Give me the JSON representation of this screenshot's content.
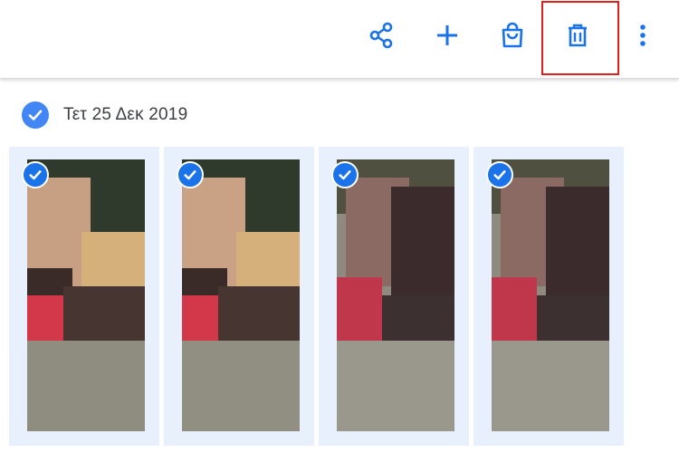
{
  "toolbar": {
    "share_icon": "share-icon",
    "add_icon": "plus-icon",
    "order_icon": "shopping-bag-icon",
    "delete_icon": "trash-icon",
    "more_icon": "more-vert-icon",
    "accent": "#1a73e8",
    "highlight_color": "#e0211b"
  },
  "group": {
    "date_label": "Τετ 25 Δεκ 2019",
    "selected": true,
    "check_color": "#4285f4"
  },
  "photos": [
    {
      "selected": true
    },
    {
      "selected": true
    },
    {
      "selected": true
    },
    {
      "selected": true
    }
  ],
  "tile_background": "#e8f0fe"
}
